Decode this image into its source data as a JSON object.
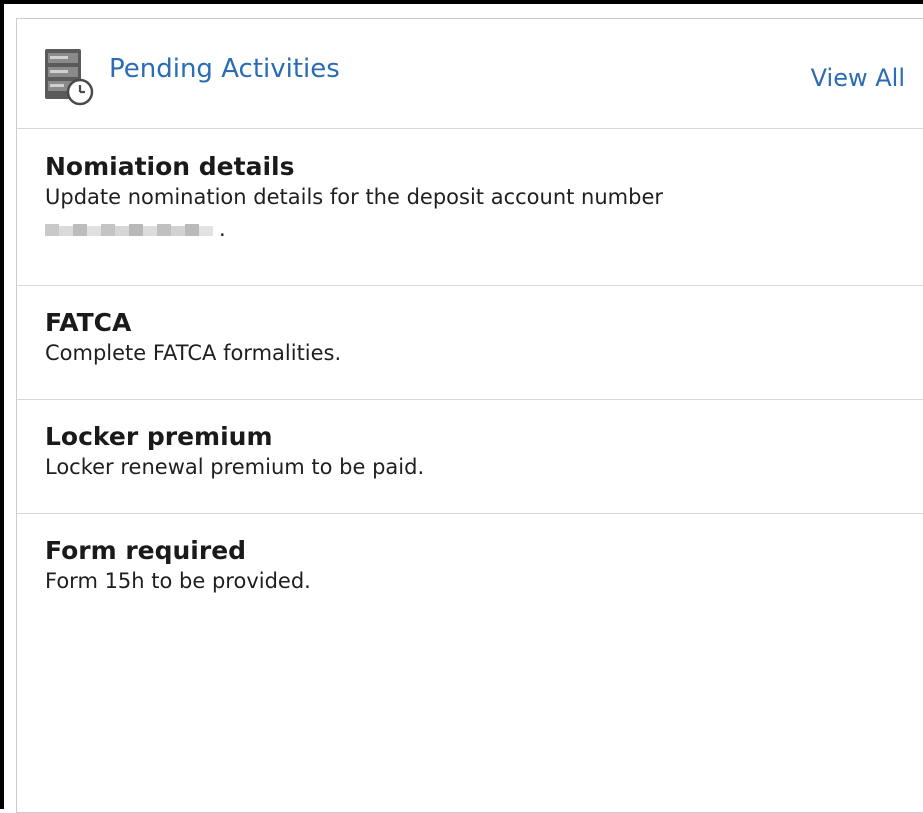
{
  "header": {
    "title": "Pending Activities",
    "view_all_label": "View All",
    "icon": "server-clock-icon",
    "title_color": "#2a6cb5"
  },
  "items": [
    {
      "title": "Nomiation details",
      "description": "Update nomination details for the deposit account number",
      "masked_suffix": "."
    },
    {
      "title": "FATCA",
      "description": "Complete FATCA formalities."
    },
    {
      "title": "Locker premium",
      "description": "Locker renewal premium to be paid."
    },
    {
      "title": "Form required",
      "description": "Form 15h to be provided."
    }
  ]
}
